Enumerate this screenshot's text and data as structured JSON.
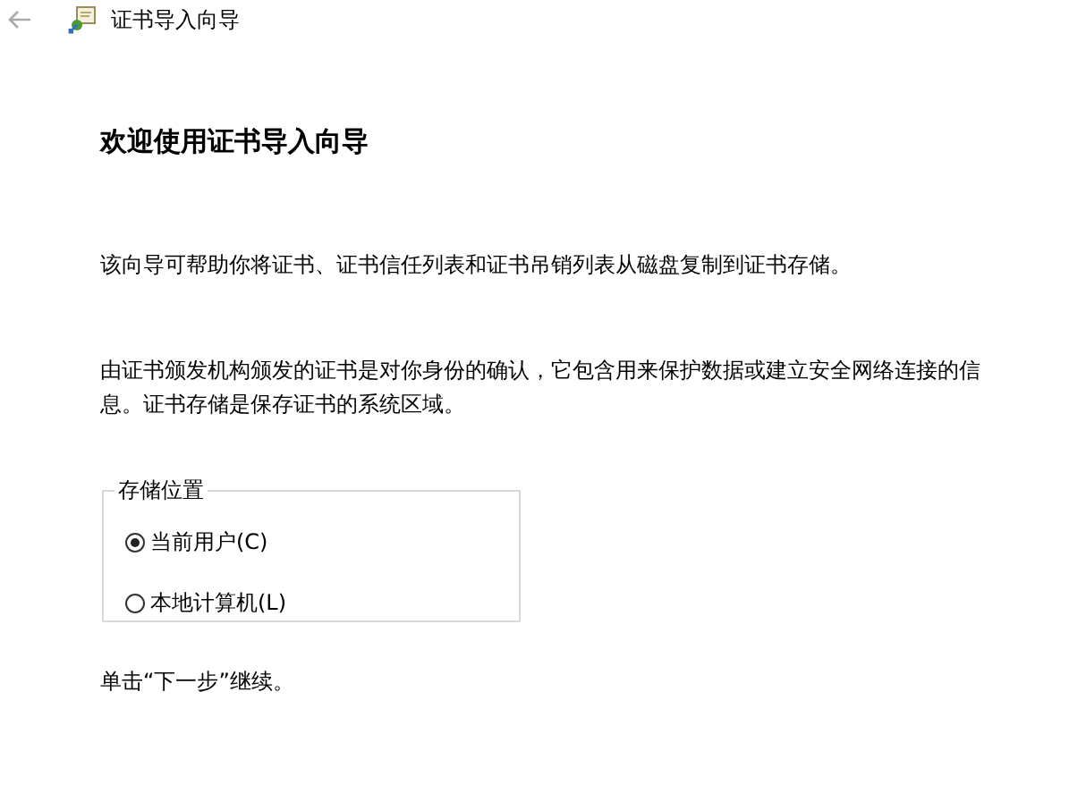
{
  "window": {
    "title": "证书导入向导"
  },
  "heading": "欢迎使用证书导入向导",
  "paragraphs": [
    "该向导可帮助你将证书、证书信任列表和证书吊销列表从磁盘复制到证书存储。",
    "由证书颁发机构颁发的证书是对你身份的确认，它包含用来保护数据或建立安全网络连接的信息。证书存储是保存证书的系统区域。"
  ],
  "store_location": {
    "label": "存储位置",
    "options": [
      {
        "label": "当前用户(C)",
        "selected": true
      },
      {
        "label": "本地计算机(L)",
        "selected": false
      }
    ]
  },
  "footer": "单击“下一步”继续。"
}
